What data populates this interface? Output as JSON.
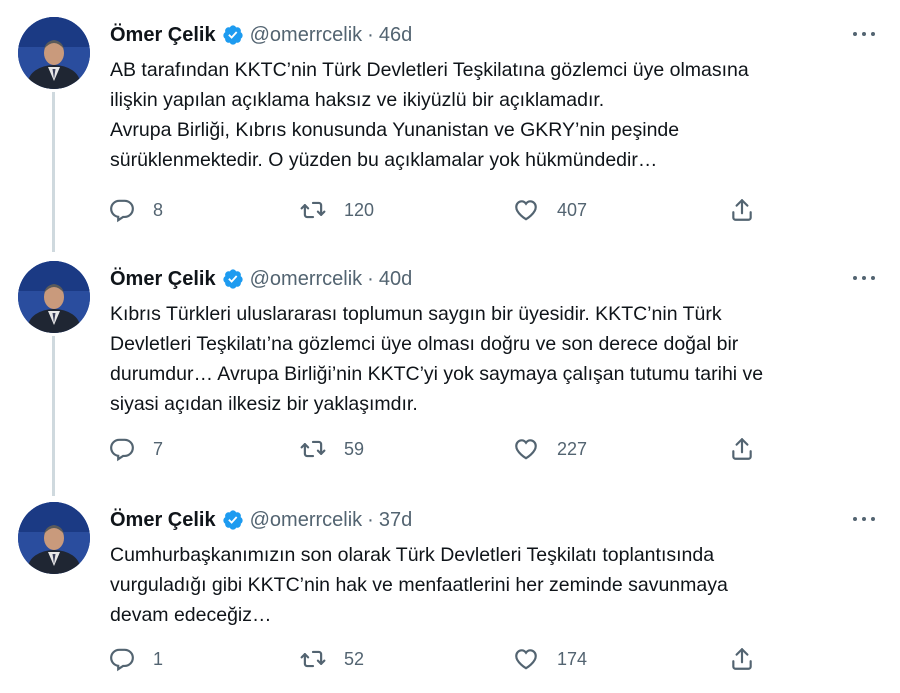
{
  "tweets": [
    {
      "name": "Ömer Çelik",
      "handle": "@omerrcelik",
      "separator": "·",
      "time": "46d",
      "text": "AB tarafından KKTC’nin Türk Devletleri Teşkilatına gözlemci üye olmasına\nilişkin yapılan açıklama haksız ve ikiyüzlü bir açıklamadır.\nAvrupa Birliği, Kıbrıs konusunda Yunanistan ve GKRY’nin peşinde\nsürüklenmektedir. O yüzden bu açıklamalar yok hükmündedir…",
      "replies": "8",
      "retweets": "120",
      "likes": "407"
    },
    {
      "name": "Ömer Çelik",
      "handle": "@omerrcelik",
      "separator": "·",
      "time": "40d",
      "text": "Kıbrıs Türkleri uluslararası toplumun saygın bir üyesidir. KKTC’nin Türk\nDevletleri Teşkilatı’na gözlemci üye olması doğru ve son derece doğal bir\ndurumdur… Avrupa Birliği’nin KKTC’yi yok saymaya çalışan tutumu tarihi ve\nsiyasi açıdan ilkesiz bir yaklaşımdır.",
      "replies": "7",
      "retweets": "59",
      "likes": "227"
    },
    {
      "name": "Ömer Çelik",
      "handle": "@omerrcelik",
      "separator": "·",
      "time": "37d",
      "text": "Cumhurbaşkanımızın son olarak Türk Devletleri Teşkilatı toplantısında\nvurguladığı gibi KKTC’nin hak ve menfaatlerini her zeminde savunmaya\ndevam edeceğiz…",
      "replies": "1",
      "retweets": "52",
      "likes": "174"
    }
  ],
  "colors": {
    "text": "#0f1419",
    "secondary": "#536471",
    "verified": "#1d9bf0",
    "connector": "#cfd9de"
  },
  "icons": {
    "verified": "verified-badge-icon",
    "more": "more-horizontal-icon",
    "reply": "reply-icon",
    "retweet": "retweet-icon",
    "like": "like-icon",
    "share": "share-icon"
  }
}
